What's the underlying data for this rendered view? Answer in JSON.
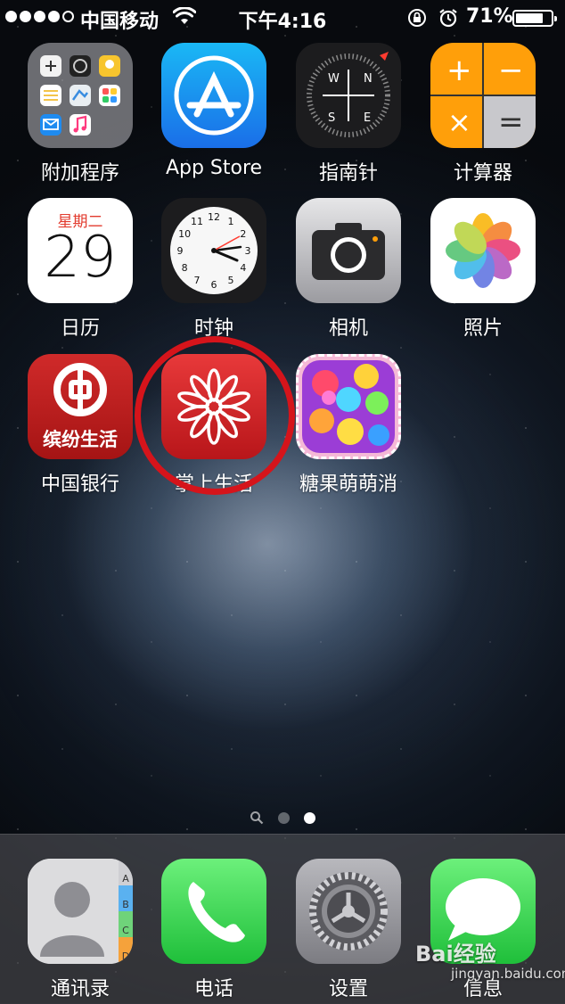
{
  "status_bar": {
    "carrier": "中国移动",
    "time": "下午4:16",
    "battery_percent": "71%",
    "battery_level": 0.71,
    "signal_bars_filled": 4,
    "signal_bars_total": 5
  },
  "home": {
    "apps": [
      {
        "label": "附加程序",
        "icon": "folder-icon"
      },
      {
        "label": "App Store",
        "icon": "app-store-icon"
      },
      {
        "label": "指南针",
        "icon": "compass-icon"
      },
      {
        "label": "计算器",
        "icon": "calculator-icon"
      },
      {
        "label": "日历",
        "icon": "calendar-icon"
      },
      {
        "label": "时钟",
        "icon": "clock-icon"
      },
      {
        "label": "相机",
        "icon": "camera-icon"
      },
      {
        "label": "照片",
        "icon": "photos-icon"
      },
      {
        "label": "中国银行",
        "icon": "boc-icon"
      },
      {
        "label": "掌上生活",
        "icon": "flower-icon"
      },
      {
        "label": "糖果萌萌消",
        "icon": "candy-game-icon"
      }
    ],
    "calendar": {
      "weekday": "星期二",
      "day": "29"
    },
    "boc_caption": "缤纷生活",
    "compass_letters": {
      "n": "N",
      "s": "S",
      "e": "E",
      "w": "W"
    },
    "calculator_symbols": {
      "plus": "+",
      "minus": "−",
      "times": "×",
      "equals": "="
    },
    "clock_numbers": [
      "12",
      "1",
      "2",
      "3",
      "4",
      "5",
      "6",
      "7",
      "8",
      "9",
      "10",
      "11"
    ],
    "page_count": 3,
    "active_page": 2
  },
  "dock": {
    "apps": [
      {
        "label": "通讯录",
        "icon": "contacts-icon"
      },
      {
        "label": "电话",
        "icon": "phone-icon"
      },
      {
        "label": "设置",
        "icon": "settings-icon"
      },
      {
        "label": "信息",
        "icon": "messages-icon"
      }
    ],
    "contacts_tabs": [
      "A",
      "B",
      "C",
      "D"
    ]
  },
  "watermark": {
    "brand": "Bai经验",
    "url": "jingyan.baidu.com"
  },
  "colors": {
    "highlight": "#d5141b",
    "calendar_red": "#e23b2e",
    "messages_green": "#4cd964",
    "appstore_blue": "#1a8cf0"
  }
}
